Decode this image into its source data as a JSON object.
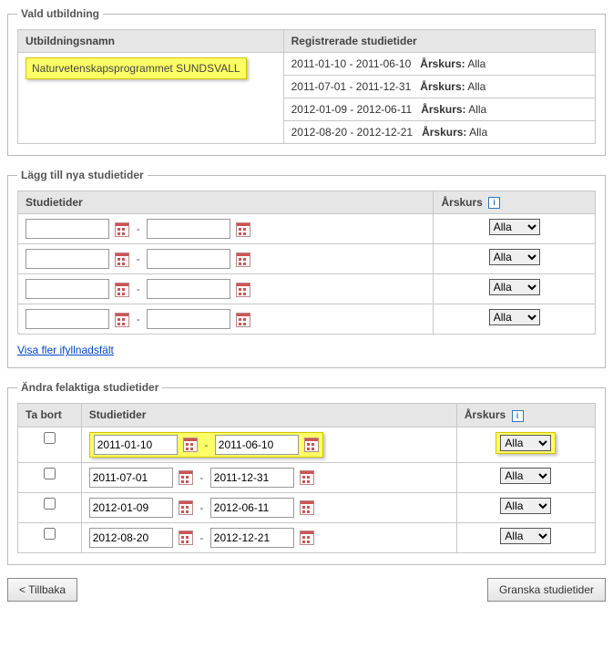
{
  "section_vald": {
    "legend": "Vald utbildning",
    "headers": {
      "name": "Utbildningsnamn",
      "reg": "Registrerade studietider"
    },
    "program_name": "Naturvetenskapsprogrammet SUNDSVALL",
    "reg_rows": [
      {
        "range": "2011-01-10 - 2011-06-10",
        "arskurs_label": "Årskurs:",
        "arskurs": "Alla"
      },
      {
        "range": "2011-07-01 - 2011-12-31",
        "arskurs_label": "Årskurs:",
        "arskurs": "Alla"
      },
      {
        "range": "2012-01-09 - 2012-06-11",
        "arskurs_label": "Årskurs:",
        "arskurs": "Alla"
      },
      {
        "range": "2012-08-20 - 2012-12-21",
        "arskurs_label": "Årskurs:",
        "arskurs": "Alla"
      }
    ]
  },
  "section_add": {
    "legend": "Lägg till nya studietider",
    "headers": {
      "tider": "Studietider",
      "arskurs": "Årskurs"
    },
    "rows": [
      {
        "from": "",
        "to": "",
        "arskurs": "Alla"
      },
      {
        "from": "",
        "to": "",
        "arskurs": "Alla"
      },
      {
        "from": "",
        "to": "",
        "arskurs": "Alla"
      },
      {
        "from": "",
        "to": "",
        "arskurs": "Alla"
      }
    ],
    "more_link": "Visa fler ifyllnadsfält"
  },
  "section_edit": {
    "legend": "Ändra felaktiga studietider",
    "headers": {
      "tabort": "Ta bort",
      "tider": "Studietider",
      "arskurs": "Årskurs"
    },
    "rows": [
      {
        "from": "2011-01-10",
        "to": "2011-06-10",
        "arskurs": "Alla",
        "highlighted": true
      },
      {
        "from": "2011-07-01",
        "to": "2011-12-31",
        "arskurs": "Alla",
        "highlighted": false
      },
      {
        "from": "2012-01-09",
        "to": "2012-06-11",
        "arskurs": "Alla",
        "highlighted": false
      },
      {
        "from": "2012-08-20",
        "to": "2012-12-21",
        "arskurs": "Alla",
        "highlighted": false
      }
    ]
  },
  "arskurs_options": [
    "Alla"
  ],
  "buttons": {
    "back": "< Tillbaka",
    "review": "Granska studietider"
  },
  "info_icon": "i"
}
